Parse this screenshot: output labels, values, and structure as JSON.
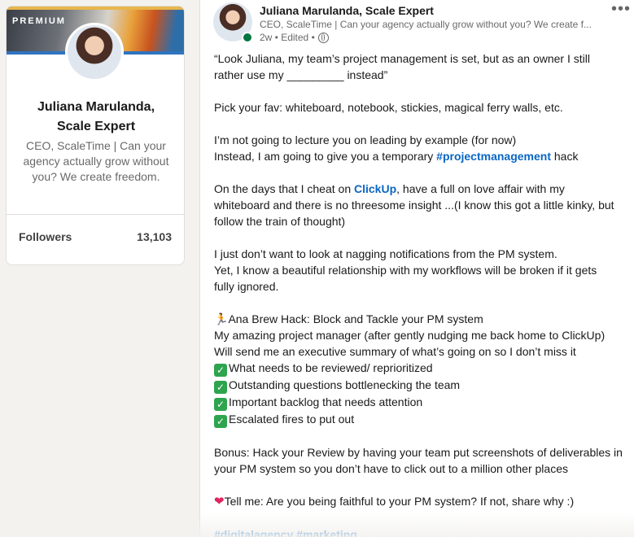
{
  "profile_card": {
    "banner_label": "PREMIUM",
    "name_line1": "Juliana Marulanda,",
    "name_line2": "Scale Expert",
    "headline": "CEO, ScaleTime | Can your agency actually grow without you? We create freedom.",
    "followers_label": "Followers",
    "followers_count": "13,103"
  },
  "post": {
    "author": "Juliana Marulanda, Scale Expert",
    "author_subtitle": "CEO, ScaleTime | Can your agency actually grow without you? We create f...",
    "meta": "2w • Edited •",
    "more_label": "•••",
    "lines": {
      "l1": "“Look Juliana, my team’s project management is set, but as an owner I still",
      "l2": "rather use my _________ instead”",
      "l3": "Pick your fav: whiteboard, notebook, stickies, magical ferry walls, etc.",
      "l4": "I’m not going to lecture you on leading by example (for now)",
      "l5_pre": "Instead, I am going to give you a temporary ",
      "l5_tag": "#projectmanagement",
      "l5_post": " hack",
      "l6_pre": "On the days that I cheat on ",
      "l6_link": "ClickUp",
      "l6_post": ", have a full on love affair with my",
      "l7": "whiteboard and there is no threesome insight ...(I know this got a little kinky, but",
      "l8": "follow the train of thought)",
      "l9": "I just don’t want to look at nagging notifications from the PM system.",
      "l10": "Yet, I know a beautiful relationship with my workflows will be broken if it gets",
      "l11": "fully ignored.",
      "l12": "Ana Brew Hack: Block and Tackle your PM system",
      "l13": "My amazing project manager (after gently nudging me back home to ClickUp)",
      "l14": "Will send me an executive summary of what’s going on so I don’t miss it",
      "c1": "What needs to be reviewed/ reprioritized",
      "c2": "Outstanding questions bottlenecking the team",
      "c3": "Important backlog that needs attention",
      "c4": "Escalated fires to put out",
      "l15": "Bonus: Hack your Review by having your team put screenshots of deliverables in",
      "l16": "your PM system so you don’t have to click out to a million other places",
      "l17": "Tell me: Are you being faithful to your PM system? If not, share why :)",
      "tag1": "#digitalagency",
      "tag2": "#marketing"
    }
  },
  "icons": {
    "check": "✓",
    "heart": "❤",
    "runner": "🏃"
  },
  "colors": {
    "link": "#0a66c2",
    "online": "#057642",
    "check": "#2ea44f"
  }
}
